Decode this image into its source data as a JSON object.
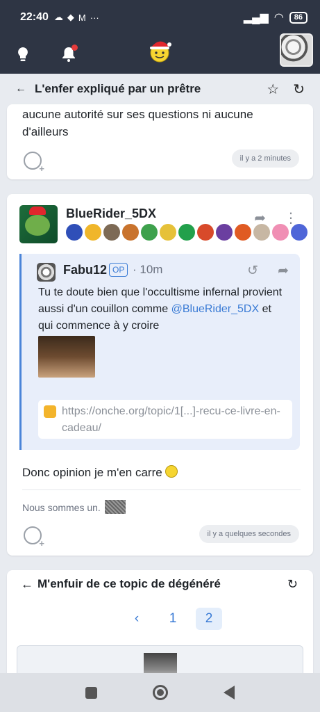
{
  "status_bar": {
    "time": "22:40",
    "battery": "86"
  },
  "topic": {
    "title": "L'enfer expliqué par un prêtre"
  },
  "prev_post": {
    "text": "aucune autorité sur ses questions ni aucune d'ailleurs",
    "time": "il y a 2 minutes"
  },
  "post": {
    "username": "BlueRider_5DX",
    "quote": {
      "author": "Fabu12",
      "op_label": "OP",
      "time": "· 10m",
      "text_before": "Tu te doute bien que l'occultisme infernal provient aussi d'un couillon comme",
      "mention": "@BlueRider_5DX",
      "text_after": "et qui commence à y croire",
      "link": "https://onche.org/topic/1[...]-recu-ce-livre-en-cadeau/"
    },
    "body": "Donc opinion je m'en carre",
    "signature": "Nous sommes un.",
    "time": "il y a quelques secondes"
  },
  "footer_nav": {
    "title": "M'enfuir de ce topic de dégénéré",
    "prev": "‹",
    "pages": [
      "1",
      "2"
    ],
    "current_page": "2"
  },
  "badge_colors": [
    "#2f4fb8",
    "#f0b62a",
    "#7d6a55",
    "#c9732d",
    "#3ea14c",
    "#e6c139",
    "#22a04b",
    "#d84a2a",
    "#6b3fa0",
    "#e05b23",
    "#c7b7a3",
    "#f08fb4",
    "#4f66d8"
  ]
}
